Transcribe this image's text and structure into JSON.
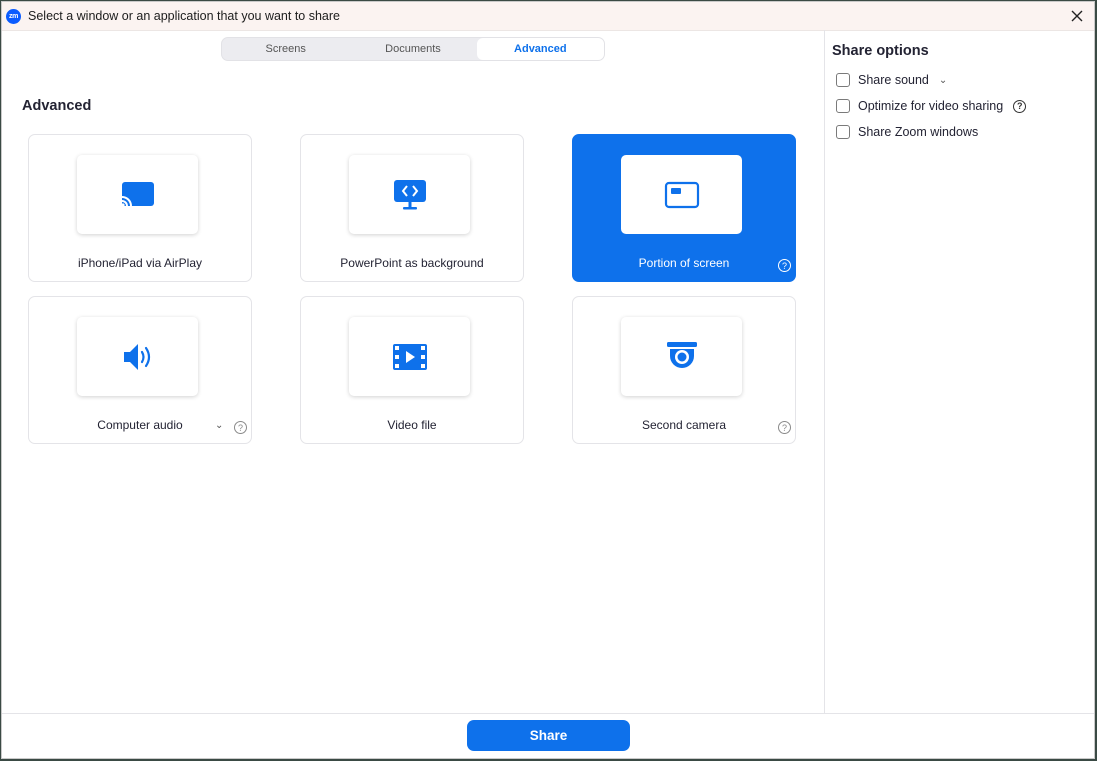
{
  "window": {
    "title": "Select a window or an application that you want to share",
    "logo_text": "zm"
  },
  "tabs": [
    {
      "label": "Screens",
      "active": false
    },
    {
      "label": "Documents",
      "active": false
    },
    {
      "label": "Advanced",
      "active": true
    }
  ],
  "section_title": "Advanced",
  "cards": [
    {
      "label": "iPhone/iPad via AirPlay",
      "icon": "airplay-icon",
      "selected": false
    },
    {
      "label": "PowerPoint as background",
      "icon": "presentation-icon",
      "selected": false
    },
    {
      "label": "Portion of screen",
      "icon": "screen-portion-icon",
      "selected": true
    },
    {
      "label": "Computer audio",
      "icon": "speaker-icon",
      "selected": false
    },
    {
      "label": "Video file",
      "icon": "film-icon",
      "selected": false
    },
    {
      "label": "Second camera",
      "icon": "camera-icon",
      "selected": false
    }
  ],
  "share_options": {
    "title": "Share options",
    "items": [
      {
        "label": "Share sound",
        "checked": false
      },
      {
        "label": "Optimize for video sharing",
        "checked": false
      },
      {
        "label": "Share Zoom windows",
        "checked": false
      }
    ]
  },
  "footer": {
    "share_label": "Share"
  },
  "colors": {
    "accent": "#0e71eb",
    "text": "#232333"
  }
}
